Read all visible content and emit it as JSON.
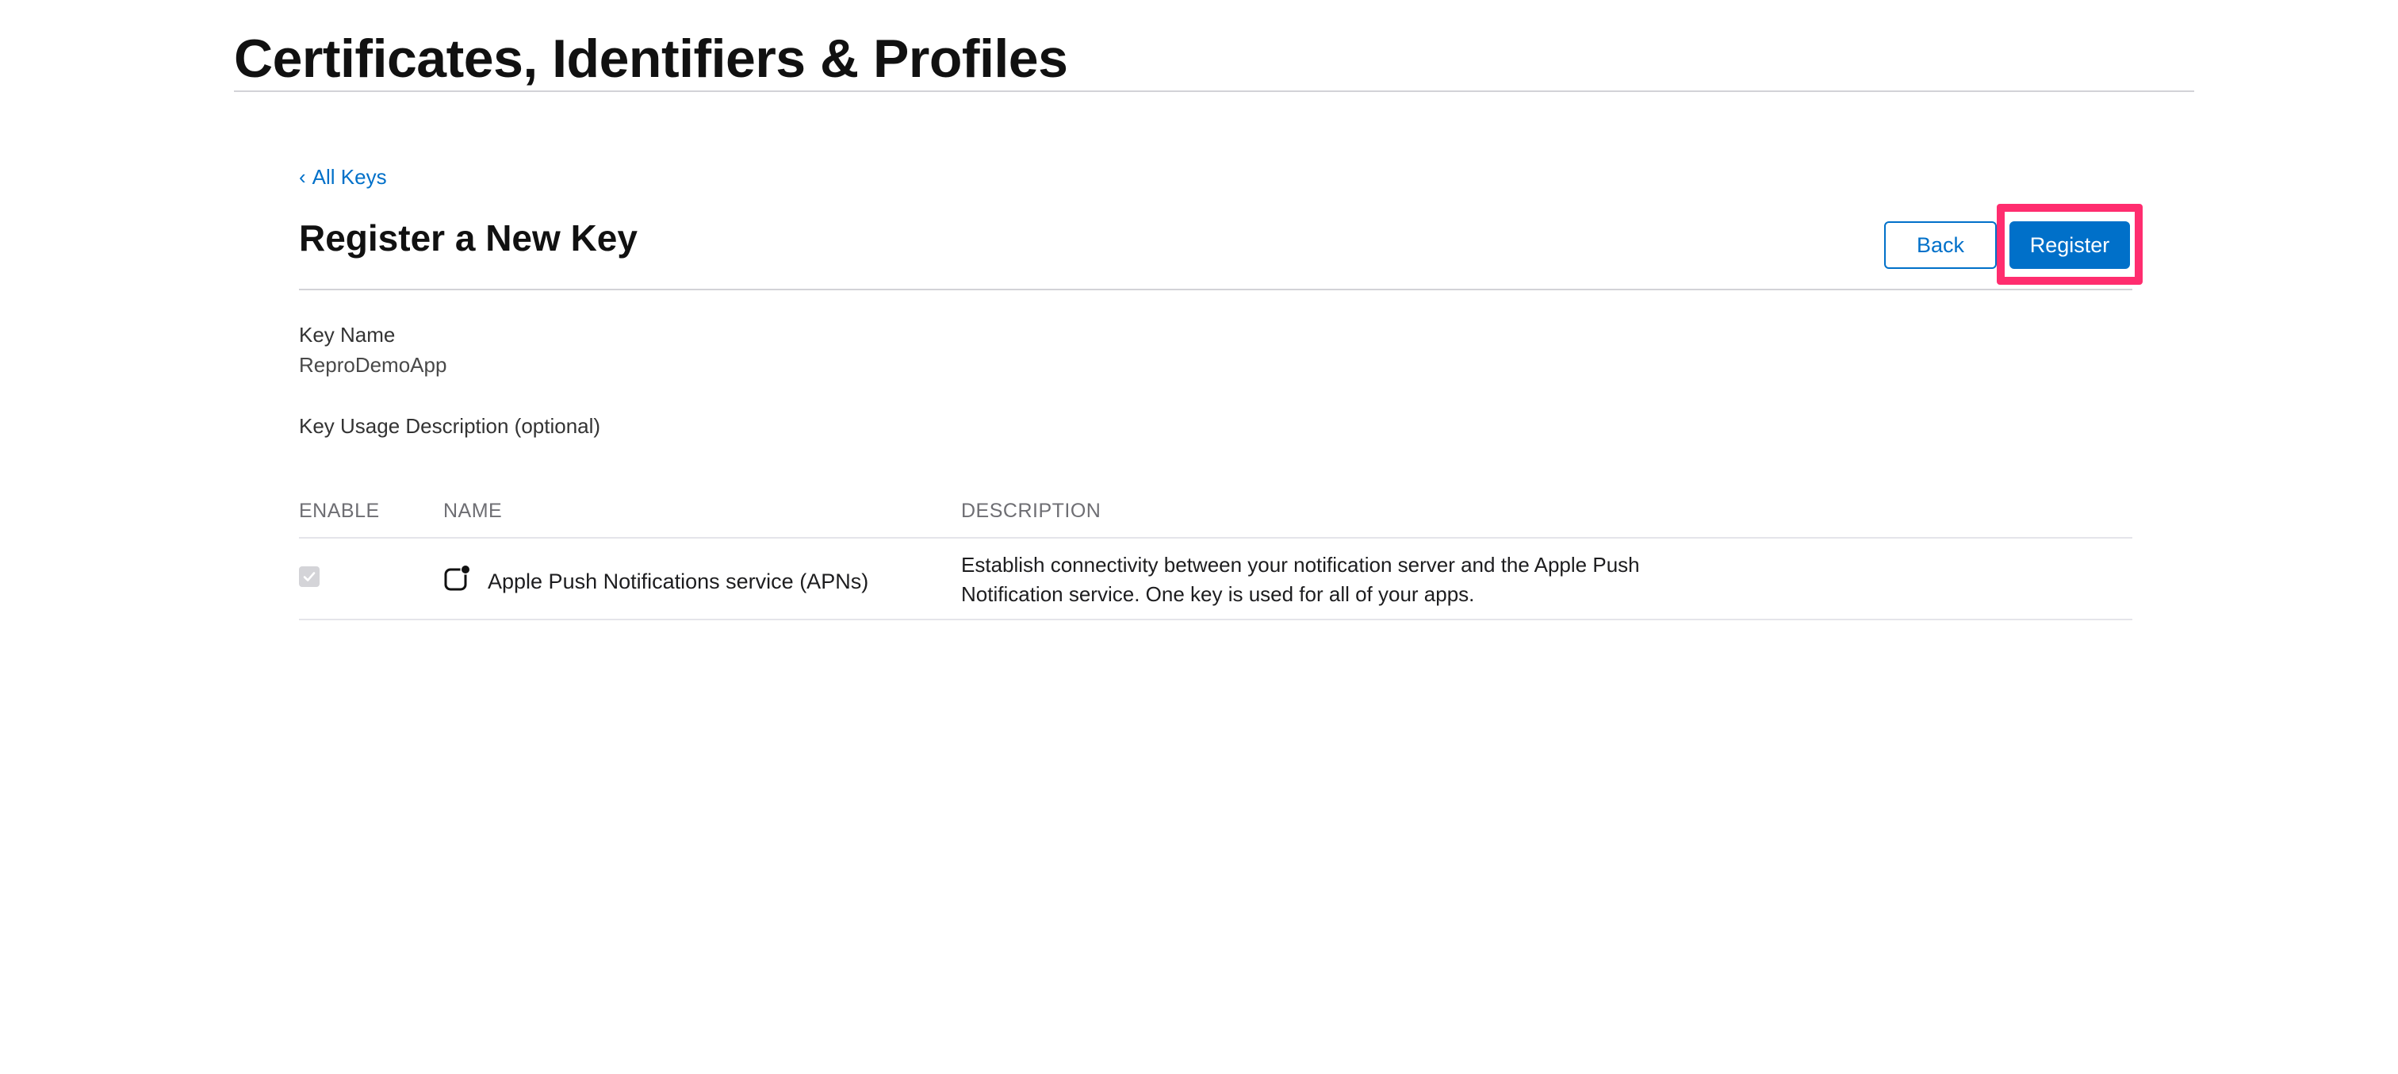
{
  "page": {
    "title": "Certificates, Identifiers & Profiles"
  },
  "breadcrumb": {
    "back_label": "All Keys",
    "back_icon": "chevron-left-icon"
  },
  "form": {
    "heading": "Register a New Key",
    "back_button": "Back",
    "register_button": "Register",
    "key_name_label": "Key Name",
    "key_name_value": "ReproDemoApp",
    "key_usage_label": "Key Usage Description (optional)"
  },
  "services_table": {
    "columns": [
      "ENABLE",
      "NAME",
      "DESCRIPTION"
    ],
    "rows": [
      {
        "enabled": true,
        "name": "Apple Push Notifications service (APNs)",
        "icon": "push-notification-icon",
        "description": "Establish connectivity between your notification server and the Apple Push Notification service. One key is used for all of your apps."
      }
    ]
  },
  "colors": {
    "accent": "#0070c9",
    "highlight": "#ff2d6f",
    "divider": "#d2d2d7"
  }
}
